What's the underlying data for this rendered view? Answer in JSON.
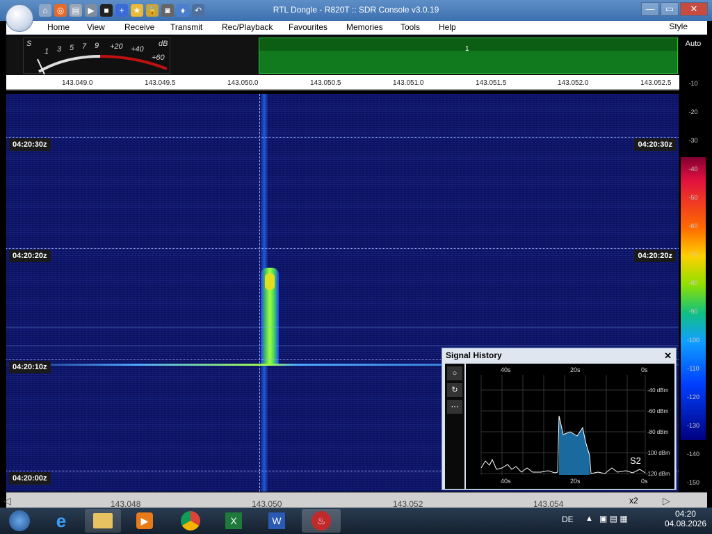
{
  "window": {
    "title": "RTL Dongle - R820T :: SDR Console v3.0.19"
  },
  "menu": [
    "Home",
    "View",
    "Receive",
    "Transmit",
    "Rec/Playback",
    "Favourites",
    "Memories",
    "Tools",
    "Help"
  ],
  "style_label": "Style",
  "smeter": {
    "s_label": "S",
    "db_label": "dB",
    "scale": [
      "1",
      "3",
      "5",
      "7",
      "9",
      "+20",
      "+40",
      "+60"
    ]
  },
  "mini_marker": "1",
  "freq_scale": [
    "143.049.0",
    "143.049.5",
    "143.050.0",
    "143.050.5",
    "143.051.0",
    "143.051.5",
    "143.052.0",
    "143.052.5"
  ],
  "time_labels": [
    "04:20:30z",
    "04:20:20z",
    "04:20:10z",
    "04:20:00z"
  ],
  "colorbar": {
    "auto": "Auto",
    "ticks": [
      "-10",
      "-20",
      "-30",
      "-40",
      "-50",
      "-60",
      "-70",
      "-80",
      "-90",
      "-100",
      "-110",
      "-120",
      "-130",
      "-140",
      "-150"
    ]
  },
  "signal_history": {
    "title": "Signal History",
    "x_top": [
      "40s",
      "20s",
      "0s"
    ],
    "x_bottom": [
      "40s",
      "20s",
      "0s"
    ],
    "y": [
      "-40 dBm",
      "-60 dBm",
      "-80 dBm",
      "-100 dBm",
      "-120 dBm"
    ],
    "s_reading": "S2"
  },
  "bottom": {
    "freqs": [
      "143.048",
      "143.050",
      "143.052",
      "143.054"
    ],
    "zoom": "x2"
  },
  "taskbar": {
    "lang": "DE",
    "time": "04:20",
    "date": "04.08.2026"
  }
}
